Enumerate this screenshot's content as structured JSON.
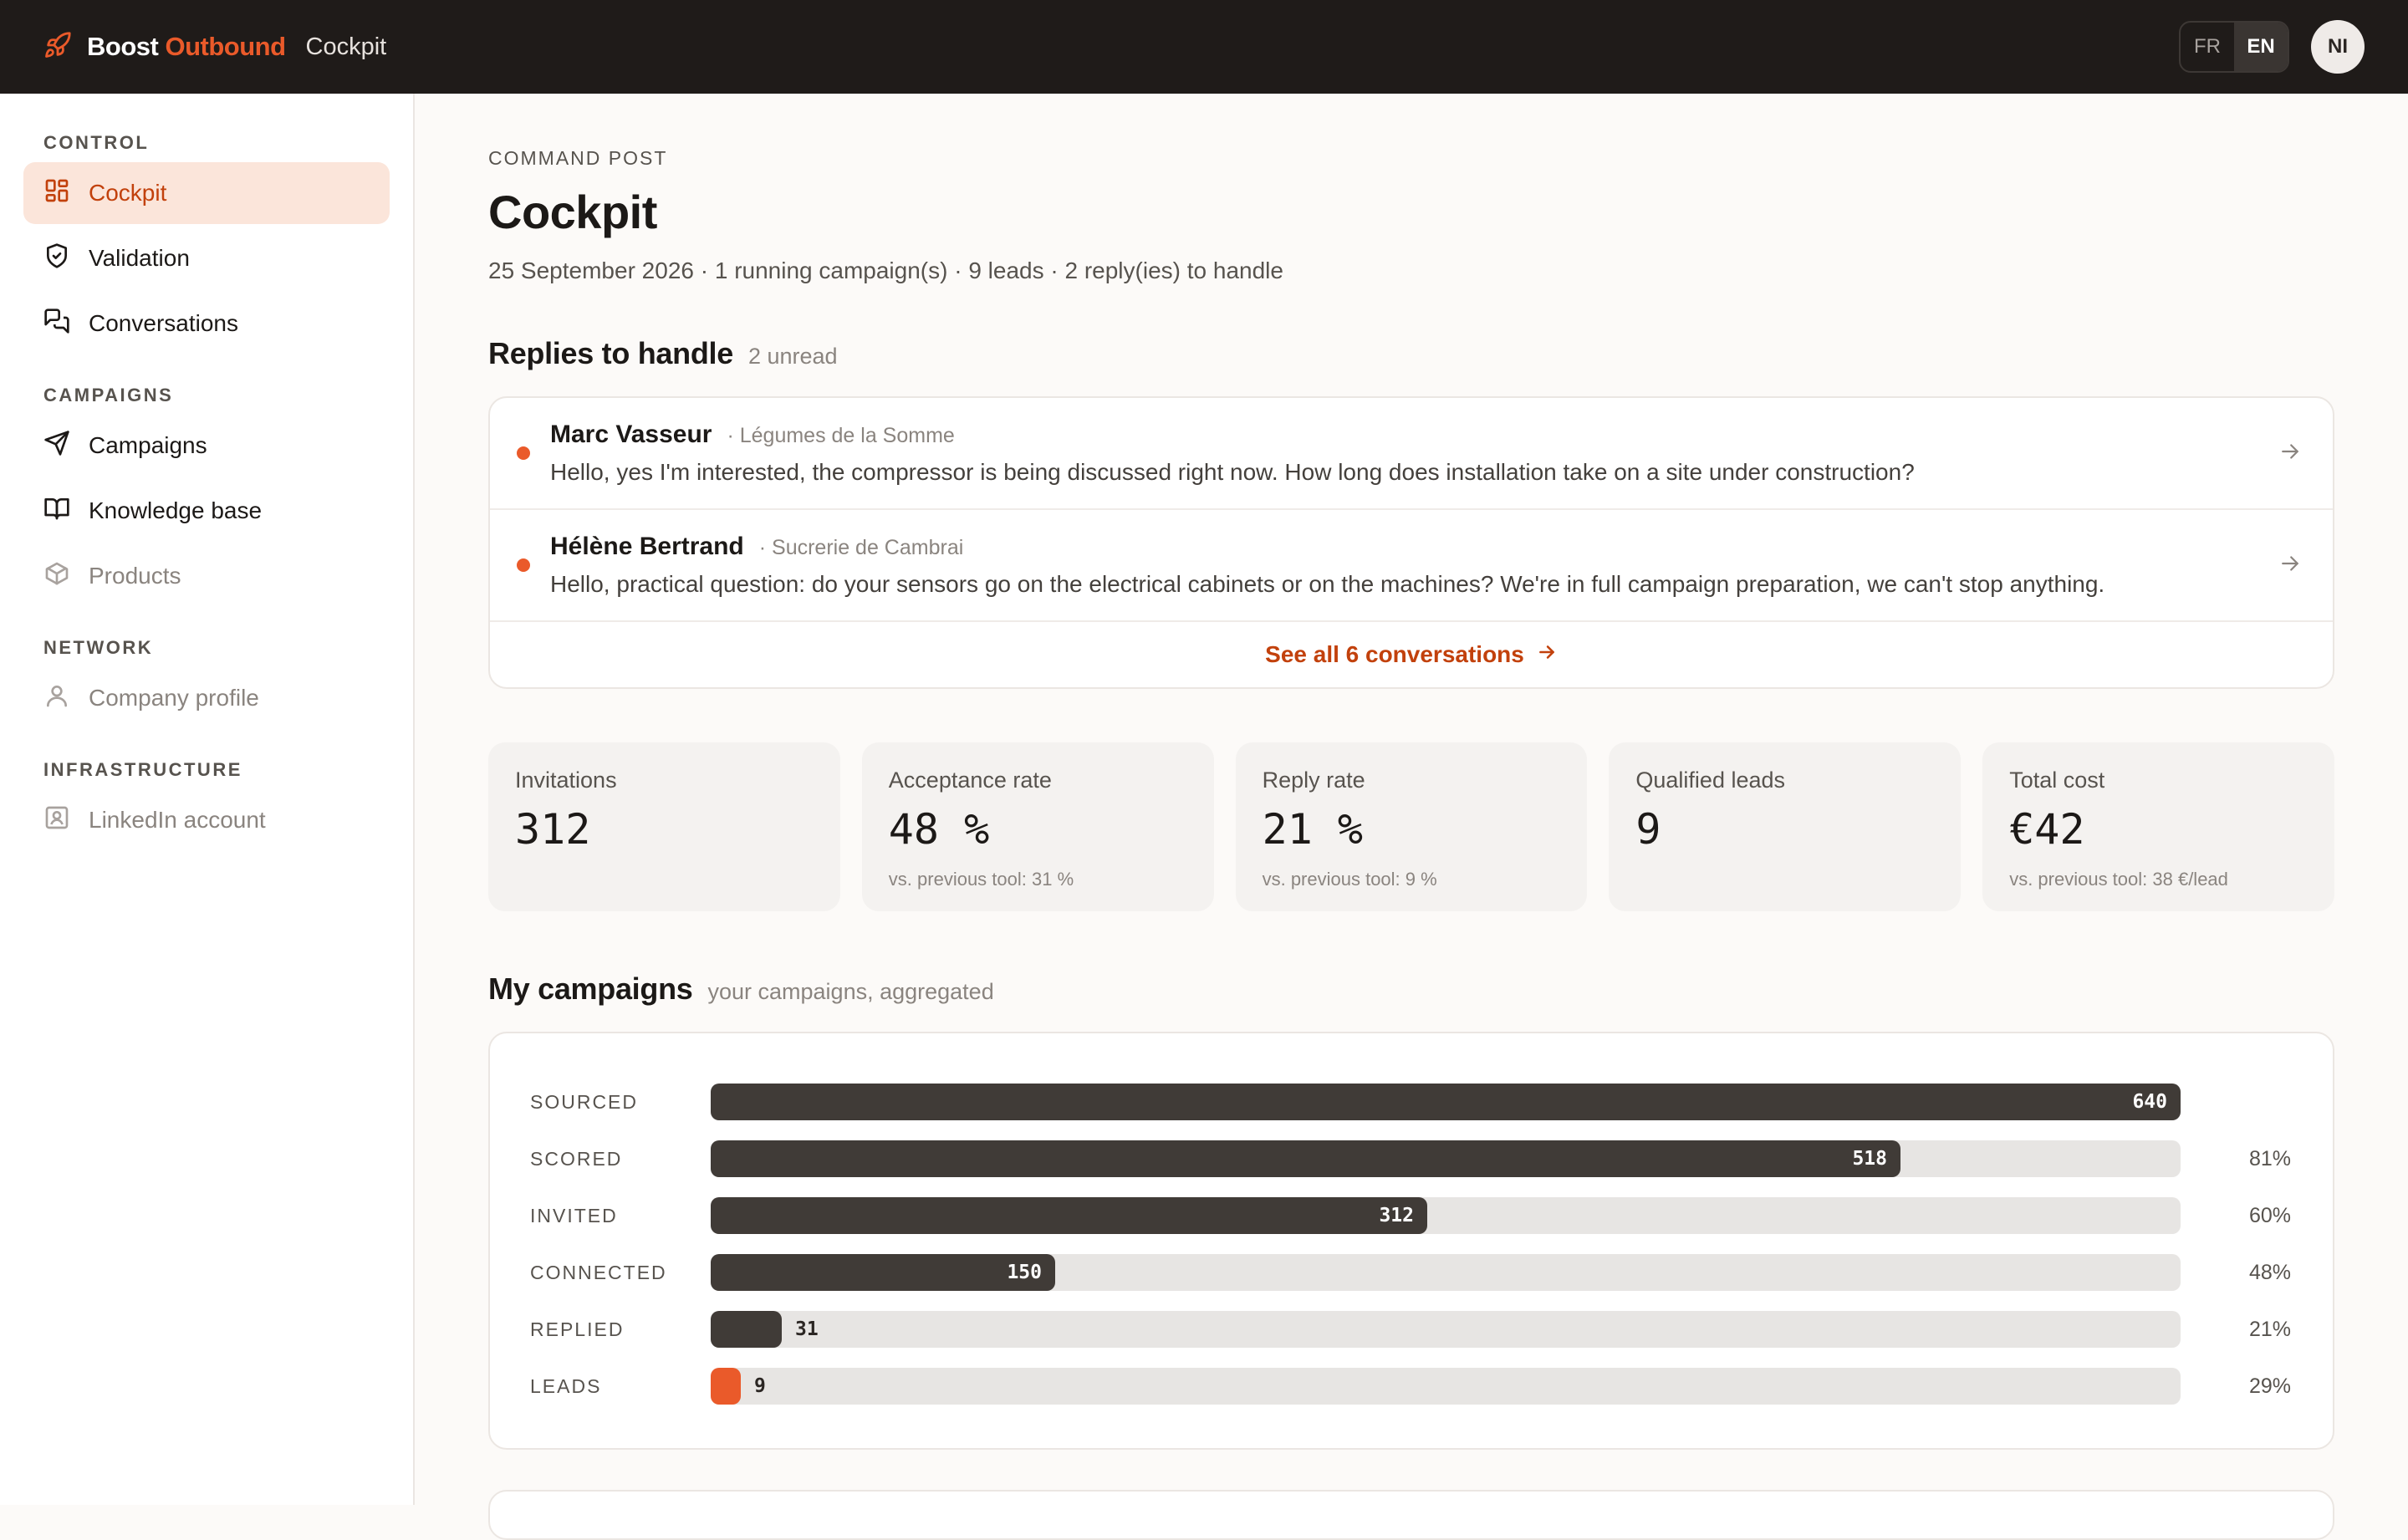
{
  "topbar": {
    "brand_part1": "Boost",
    "brand_part2": "Outbound",
    "page": "Cockpit",
    "lang_fr": "FR",
    "lang_en": "EN",
    "avatar_initials": "NI"
  },
  "sidebar": {
    "sections": [
      {
        "title": "CONTROL",
        "items": [
          {
            "label": "Cockpit",
            "icon": "dashboard-icon",
            "state": "active"
          },
          {
            "label": "Validation",
            "icon": "shield-check-icon",
            "state": "normal"
          },
          {
            "label": "Conversations",
            "icon": "chat-icon",
            "state": "normal"
          }
        ]
      },
      {
        "title": "CAMPAIGNS",
        "items": [
          {
            "label": "Campaigns",
            "icon": "send-icon",
            "state": "normal"
          },
          {
            "label": "Knowledge base",
            "icon": "book-icon",
            "state": "normal"
          },
          {
            "label": "Products",
            "icon": "box-icon",
            "state": "disabled"
          }
        ]
      },
      {
        "title": "NETWORK",
        "items": [
          {
            "label": "Company profile",
            "icon": "user-icon",
            "state": "disabled"
          }
        ]
      },
      {
        "title": "INFRASTRUCTURE",
        "items": [
          {
            "label": "LinkedIn account",
            "icon": "id-card-icon",
            "state": "disabled"
          }
        ]
      }
    ]
  },
  "header": {
    "eyebrow": "COMMAND POST",
    "title": "Cockpit",
    "subtitle": "25 September 2026 · 1 running campaign(s) · 9 leads · 2 reply(ies) to handle"
  },
  "replies": {
    "title": "Replies to handle",
    "meta": "2 unread",
    "items": [
      {
        "name": "Marc Vasseur",
        "company": "· Légumes de la Somme",
        "message": "Hello, yes I'm interested, the compressor is being discussed right now. How long does installation take on a site under construction?"
      },
      {
        "name": "Hélène Bertrand",
        "company": "· Sucrerie de Cambrai",
        "message": "Hello, practical question: do your sensors go on the electrical cabinets or on the machines? We're in full campaign preparation, we can't stop anything."
      }
    ],
    "see_all": "See all 6 conversations"
  },
  "kpis": [
    {
      "label": "Invitations",
      "value": "312",
      "note": ""
    },
    {
      "label": "Acceptance rate",
      "value": "48 %",
      "note": "vs. previous tool: 31 %"
    },
    {
      "label": "Reply rate",
      "value": "21 %",
      "note": "vs. previous tool: 9 %"
    },
    {
      "label": "Qualified leads",
      "value": "9",
      "note": ""
    },
    {
      "label": "Total cost",
      "value": "€42",
      "note": "vs. previous tool: 38 €/lead"
    }
  ],
  "campaigns": {
    "title": "My campaigns",
    "meta": "your campaigns, aggregated",
    "funnel": [
      {
        "label": "SOURCED",
        "value": 640,
        "pct": ""
      },
      {
        "label": "SCORED",
        "value": 518,
        "pct": "81%"
      },
      {
        "label": "INVITED",
        "value": 312,
        "pct": "60%"
      },
      {
        "label": "CONNECTED",
        "value": 150,
        "pct": "48%"
      },
      {
        "label": "REPLIED",
        "value": 31,
        "pct": "21%"
      },
      {
        "label": "LEADS",
        "value": 9,
        "pct": "29%"
      }
    ]
  },
  "colors": {
    "accent": "#ea5a2a",
    "topbar": "#1f1b19",
    "bar": "#403b37"
  }
}
